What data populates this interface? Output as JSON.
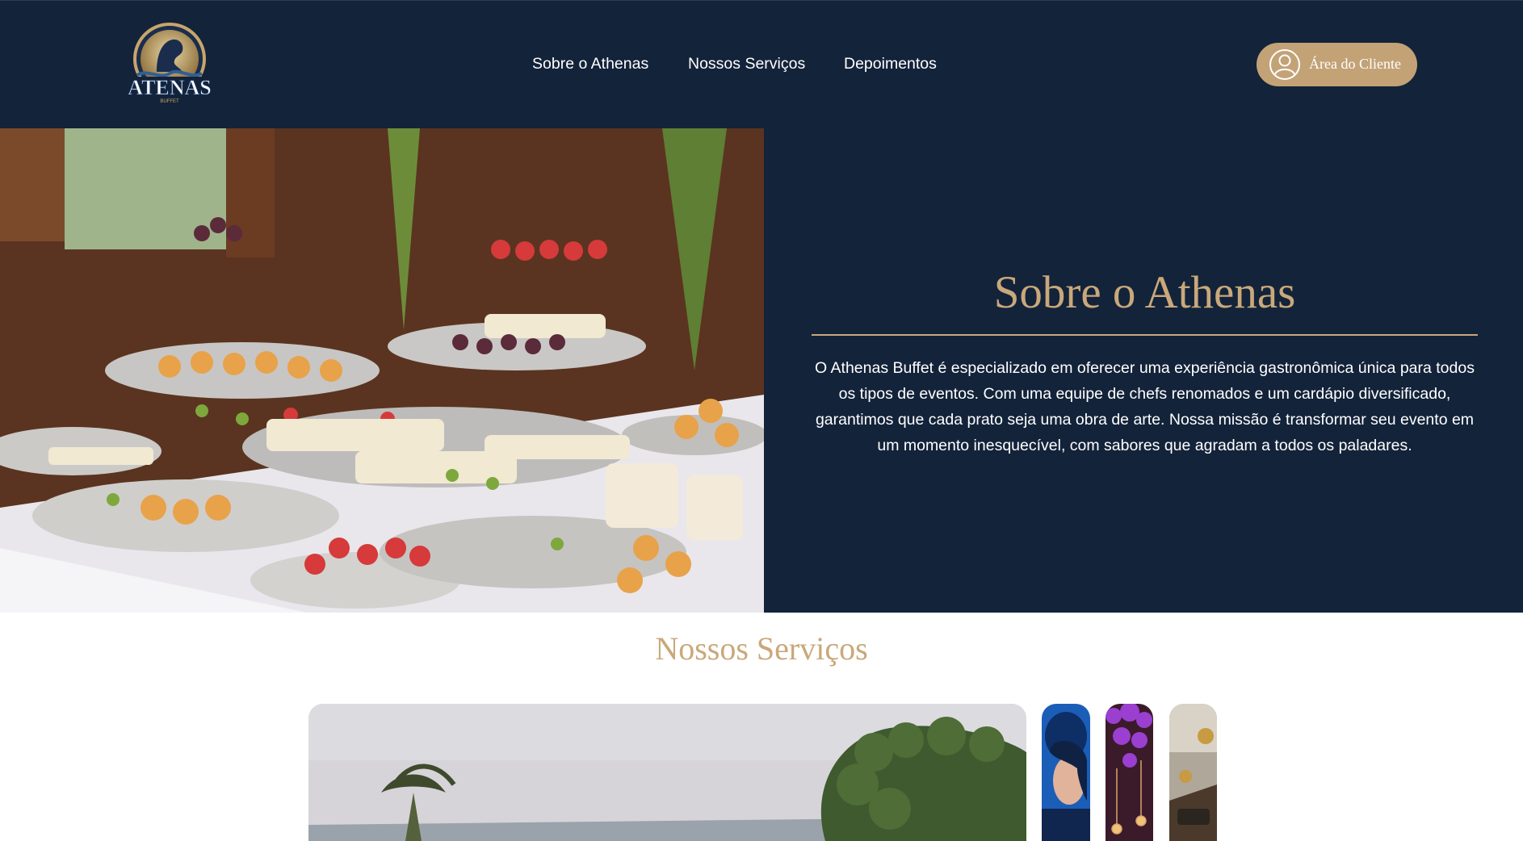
{
  "brand": {
    "logo_text": "ATENAS",
    "logo_subtext": "BUFFET"
  },
  "nav": {
    "items": [
      {
        "label": "Sobre o Athenas"
      },
      {
        "label": "Nossos Serviços"
      },
      {
        "label": "Depoimentos"
      }
    ]
  },
  "header": {
    "client_area_label": "Área do Cliente",
    "client_area_icon": "user-circle-icon"
  },
  "about": {
    "title": "Sobre o Athenas",
    "text": "O Athenas Buffet é especializado em oferecer uma experiência gastronômica única para todos os tipos de eventos. Com uma equipe de chefs renomados e um cardápio diversificado, garantimos que cada prato seja uma obra de arte. Nossa missão é transformar seu evento em um momento inesquecível, com sabores que agradam a todos os paladares."
  },
  "services": {
    "title": "Nossos Serviços"
  },
  "colors": {
    "navy": "#13233a",
    "gold": "#c9a87a",
    "button": "#c3a276",
    "white": "#ffffff"
  }
}
